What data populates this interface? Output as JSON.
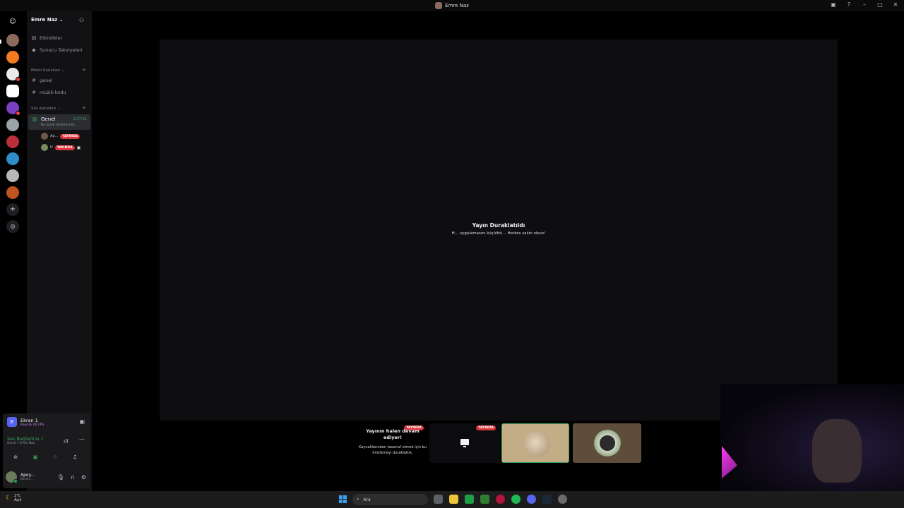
{
  "window": {
    "title": "Emre Naz"
  },
  "server": {
    "name": "Emre Naz ⌄"
  },
  "nav": {
    "events": "Etkinlikler",
    "boosts": "Sunucu Takviyeleri"
  },
  "text_category": "Metin Kanalları ⌄",
  "text_channels": [
    "genel",
    "müzik-kodu"
  ],
  "voice_category": "Ses Kanalları ⌄",
  "voice_channel": {
    "name": "Genel",
    "time": "2:37:51",
    "status": "Bu kanal durumu bel..."
  },
  "voice_users": [
    {
      "name": "Ap...",
      "live": "YAYINDA"
    },
    {
      "name": "H",
      "live": "YAYINDA"
    }
  ],
  "stream": {
    "paused_title": "Yayın Duraklatıldı",
    "paused_sub": "H... uygulamasını küçülttü... Herkes sakin olsun!"
  },
  "tiles": {
    "text_title": "Yayının halen devam ediyor!",
    "text_sub": "Kaynaklarından tasarruf etmek için bu önizlemeyi duraklattık.",
    "live": "YAYINDA"
  },
  "panel": {
    "screen_initial": "E",
    "screen_title": "Ekran 1",
    "screen_sub": "Kaynak 60 FPS",
    "voice_connected": "Ses Bağlantısı ♪",
    "voice_location": "Genel / Emre Naz",
    "username": "Apoy...",
    "user_status": "Ekran..."
  },
  "taskbar": {
    "temp": "2°C",
    "weather": "Açık",
    "search_placeholder": "Ara"
  },
  "colors": {
    "accent": "#5865f2",
    "live": "#da373c",
    "online": "#23a55a"
  }
}
